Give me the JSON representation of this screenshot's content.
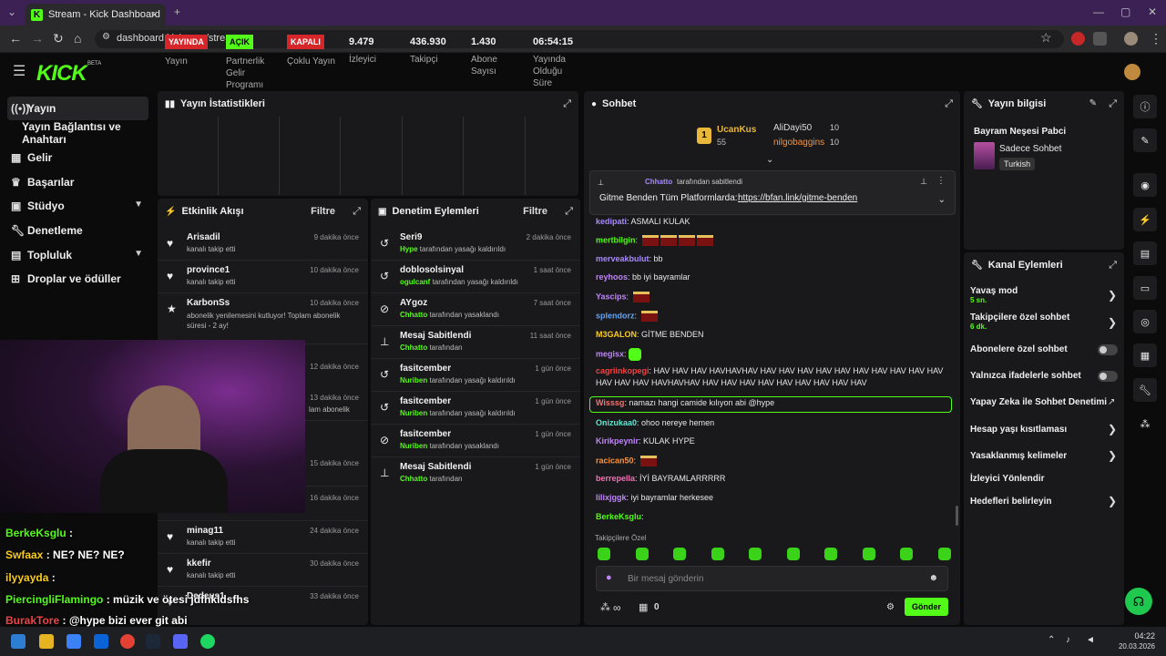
{
  "browser": {
    "tab_title": "Stream - Kick Dashboard",
    "url": "dashboard.kick.com/stream"
  },
  "brand": {
    "logo": "KICK",
    "beta": "BETA",
    "accent": "#53fc18"
  },
  "sidebar": {
    "items": [
      {
        "label": "Yayın",
        "icon": "broadcast-icon"
      },
      {
        "label": "Yayın Bağlantısı ve Anahtarı",
        "icon": ""
      },
      {
        "label": "Gelir",
        "icon": "revenue-icon"
      },
      {
        "label": "Başarılar",
        "icon": "trophy-icon"
      },
      {
        "label": "Stüdyo",
        "icon": "studio-icon"
      },
      {
        "label": "Denetleme",
        "icon": "wrench-icon"
      },
      {
        "label": "Topluluk",
        "icon": "community-icon"
      },
      {
        "label": "Droplar ve ödüller",
        "icon": "gift-icon"
      }
    ]
  },
  "stats": {
    "title": "Yayın İstatistikleri",
    "items": [
      {
        "badge": "YAYINDA",
        "label": "Yayın"
      },
      {
        "badge": "AÇIK",
        "label": "Partnerlik Gelir Programı"
      },
      {
        "badge": "KAPALI",
        "label": "Çoklu Yayın"
      },
      {
        "value": "9.479",
        "label": "İzleyici"
      },
      {
        "value": "436.930",
        "label": "Takipçi"
      },
      {
        "value": "1.430",
        "label": "Abone Sayısı"
      },
      {
        "value": "06:54:15",
        "label": "Yayında Olduğu Süre"
      }
    ]
  },
  "activity": {
    "title": "Etkinlik Akışı",
    "filter": "Filtre",
    "rows": [
      {
        "name": "Arisadil",
        "sub": "kanalı takip etti",
        "time": "9 dakika önce"
      },
      {
        "name": "province1",
        "sub": "kanalı takip etti",
        "time": "10 dakika önce"
      },
      {
        "name": "KarbonSs",
        "sub": "abonelik yenilemesini kutluyor! Toplam abonelik süresi - 2 ay!",
        "time": "10 dakika önce"
      },
      {
        "time": "12 dakika önce"
      },
      {
        "time": "13 dakika önce",
        "sub": "lam abonelik"
      },
      {
        "time": "15 dakika önce"
      },
      {
        "time": "16 dakika önce"
      },
      {
        "name": "minag11",
        "sub": "kanalı takip etti",
        "time": "24 dakika önce"
      },
      {
        "name": "kkefir",
        "sub": "kanalı takip etti",
        "time": "30 dakika önce"
      },
      {
        "name": "Dedeus1",
        "time": "33 dakika önce"
      }
    ]
  },
  "moderation": {
    "title": "Denetim Eylemleri",
    "filter": "Filtre",
    "rows": [
      {
        "name": "Seri9",
        "actor": "Hype",
        "action": "tarafından yasağı kaldırıldı",
        "time": "2 dakika önce"
      },
      {
        "name": "doblosolsinyal",
        "actor": "ogulcanf",
        "action": "tarafından yasağı kaldırıldı",
        "time": "1 saat önce"
      },
      {
        "name": "AYgoz",
        "actor": "Chhatto",
        "action": "tarafından yasaklandı",
        "time": "7 saat önce"
      },
      {
        "name": "Mesaj Sabitlendi",
        "actor": "Chhatto",
        "action": "tarafından",
        "time": "11 saat önce"
      },
      {
        "name": "fasitcember",
        "actor": "Nuriben",
        "action": "tarafından yasağı kaldırıldı",
        "time": "1 gün önce"
      },
      {
        "name": "fasitcember",
        "actor": "Nuriben",
        "action": "tarafından yasağı kaldırıldı",
        "time": "1 gün önce"
      },
      {
        "name": "fasitcember",
        "actor": "Nuriben",
        "action": "tarafından yasaklandı",
        "time": "1 gün önce"
      },
      {
        "name": "Mesaj Sabitlendi",
        "actor": "Chhatto",
        "action": "tarafından",
        "time": "1 gün önce"
      }
    ]
  },
  "chat": {
    "title": "Sohbet",
    "leaderboard": {
      "rank": "1",
      "top": "UcanKus",
      "top_count": "55",
      "second": "AliDayi50",
      "second_count": "10",
      "third": "nilgobaggins",
      "third_count": "10"
    },
    "pinned": {
      "by": "Chhatto",
      "by_suffix": "tarafından sabitlendi",
      "text": "Gitme Benden Tüm Platformlarda:",
      "link": "https://bfan.link/gitme-benden"
    },
    "messages": [
      {
        "user": "kedipati",
        "color": "#a78bfa",
        "text": "ASMALI KULAK"
      },
      {
        "user": "mertbilgin",
        "color": "#53fc18",
        "text": "",
        "emotes": "kestik4"
      },
      {
        "user": "merveakbulut",
        "color": "#a78bfa",
        "text": "bb"
      },
      {
        "user": "reyhoos",
        "color": "#c084fc",
        "text": "bb iyi bayramlar"
      },
      {
        "user": "Yascips",
        "color": "#c084fc",
        "text": "",
        "emotes": "kestik1"
      },
      {
        "user": "splendorz",
        "color": "#60a5fa",
        "text": "",
        "emotes": "kestik1"
      },
      {
        "user": "M3GALON",
        "color": "#facc15",
        "text": "GİTME BENDEN"
      },
      {
        "user": "megisx",
        "color": "#c084fc",
        "text": "",
        "emotes": "green1"
      },
      {
        "user": "cagriinkopegi",
        "color": "#ef4444",
        "text": "HAV HAV HAV HAVHAVHAV HAV HAV HAV HAV HAV HAV HAV HAV HAV HAV",
        "text2": "HAV HAV HAV HAVHAVHAV HAV HAV HAV HAV HAV HAV HAV HAV HAV"
      },
      {
        "user": "Wisssg",
        "color": "#f87171",
        "text": "namazı hangi camide kılıyon abi @hype"
      },
      {
        "user": "Onizukaa0",
        "color": "#5eead4",
        "text": "ohoo nereye hemen"
      },
      {
        "user": "Kirikpeynir",
        "color": "#c084fc",
        "text": "KULAK HYPE"
      },
      {
        "user": "racican50",
        "color": "#fb923c",
        "text": "",
        "emotes": "kestik1"
      },
      {
        "user": "berrepella",
        "color": "#f472b6",
        "text": "İYİ BAYRAMLARRRRR"
      },
      {
        "user": "lilixjggk",
        "color": "#c084fc",
        "text": "iyi bayramlar herkesee"
      },
      {
        "user": "BerkeKsglu",
        "color": "#53fc18",
        "text": ""
      }
    ],
    "emote_bar_label": "Takipçilere Özel",
    "input_placeholder": "Bir mesaj gönderin",
    "users_count": "∞",
    "gift_count": "0",
    "send": "Gönder"
  },
  "stream_info": {
    "title": "Yayın bilgisi",
    "stream_title": "Bayram Neşesi Pabci",
    "category": "Sadece Sohbet",
    "language": "Turkish"
  },
  "channel_actions": {
    "title": "Kanal Eylemleri",
    "items": [
      {
        "label": "Yavaş mod",
        "sub": "5 sn.",
        "control": "arrow"
      },
      {
        "label": "Takipçilere özel sohbet",
        "sub": "6 dk.",
        "control": "arrow"
      },
      {
        "label": "Abonelere özel sohbet",
        "control": "toggle",
        "on": false
      },
      {
        "label": "Yalnızca ifadelerle sohbet",
        "control": "toggle",
        "on": false
      },
      {
        "label": "Yapay Zeka ile Sohbet Denetimi",
        "control": "external"
      },
      {
        "label": "Hesap yaşı kısıtlaması",
        "control": "arrow"
      },
      {
        "label": "Yasaklanmış kelimeler",
        "control": "arrow"
      },
      {
        "label": "İzleyici Yönlendir",
        "control": "none"
      },
      {
        "label": "Hedefleri belirleyin",
        "control": "arrow"
      }
    ]
  },
  "overlay_chat": [
    {
      "user": "BerkeKsglu",
      "color": "#53fc18",
      "text": ":"
    },
    {
      "user": "Swfaax",
      "color": "#facc15",
      "text": ":  NE?  NE?  NE?"
    },
    {
      "user": "ilyyayda",
      "color": "#facc15",
      "text": ":"
    },
    {
      "user": "PiercingliFlamingo",
      "color": "#53fc18",
      "text": ": müzik ve ötesi jdfhkldsfhs"
    },
    {
      "user": "BurakTore",
      "color": "#ef4444",
      "text": ": @hype bizi ever git abi"
    }
  ],
  "taskbar": {
    "time": "04:22",
    "date": "20.03.2026"
  }
}
